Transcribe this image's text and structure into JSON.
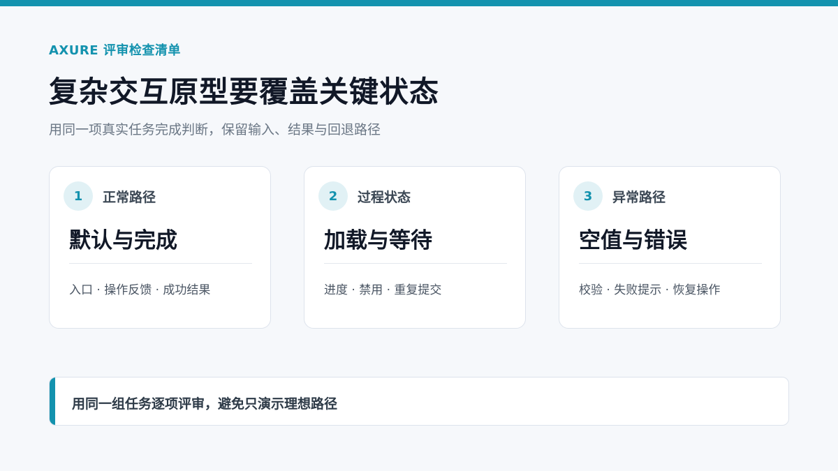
{
  "theme": {
    "accent": "#1392ae",
    "background": "#f6f8fb",
    "card_bg": "#ffffff",
    "badge_bg": "#e1f1f5",
    "title_color": "#111827",
    "muted_text": "#6b7785"
  },
  "header": {
    "eyebrow": "AXURE 评审检查清单",
    "title": "复杂交互原型要覆盖关键状态",
    "subtitle": "用同一项真实任务完成判断，保留输入、结果与回退路径"
  },
  "cards": [
    {
      "number": "1",
      "kicker": "正常路径",
      "title": "默认与完成",
      "description": "入口 · 操作反馈 · 成功结果"
    },
    {
      "number": "2",
      "kicker": "过程状态",
      "title": "加载与等待",
      "description": "进度 · 禁用 · 重复提交"
    },
    {
      "number": "3",
      "kicker": "异常路径",
      "title": "空值与错误",
      "description": "校验 · 失败提示 · 恢复操作"
    }
  ],
  "note": {
    "text": "用同一组任务逐项评审，避免只演示理想路径"
  }
}
